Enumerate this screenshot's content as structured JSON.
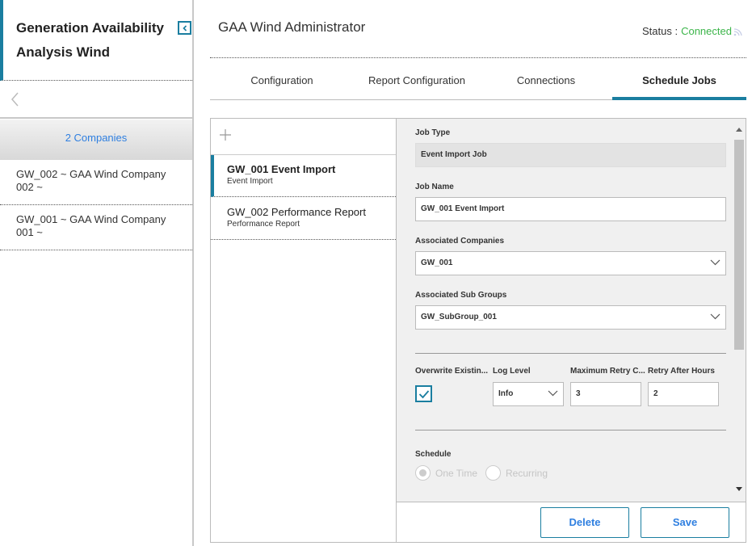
{
  "sidebar": {
    "title": "Generation Availability Analysis Wind",
    "companies_header": "2 Companies",
    "companies": [
      {
        "label": "GW_002 ~ GAA Wind Company 002 ~"
      },
      {
        "label": "GW_001 ~ GAA Wind Company 001 ~"
      }
    ]
  },
  "header": {
    "title": "GAA Wind Administrator",
    "status_label": "Status :",
    "status_value": "Connected"
  },
  "tabs": [
    {
      "label": "Configuration"
    },
    {
      "label": "Report Configuration"
    },
    {
      "label": "Connections"
    },
    {
      "label": "Schedule Jobs",
      "active": true
    }
  ],
  "jobs": [
    {
      "title": "GW_001 Event Import",
      "subtitle": "Event Import",
      "selected": true
    },
    {
      "title": "GW_002 Performance Report",
      "subtitle": "Performance Report"
    }
  ],
  "form": {
    "job_type_label": "Job Type",
    "job_type_value": "Event Import Job",
    "job_name_label": "Job Name",
    "job_name_value": "GW_001 Event Import",
    "associated_companies_label": "Associated Companies",
    "associated_companies_value": "GW_001",
    "associated_sub_groups_label": "Associated Sub Groups",
    "associated_sub_groups_value": "GW_SubGroup_001",
    "overwrite_label": "Overwrite Existin...",
    "overwrite_checked": true,
    "log_level_label": "Log Level",
    "log_level_value": "Info",
    "max_retry_label": "Maximum Retry C...",
    "max_retry_value": "3",
    "retry_after_label": "Retry After Hours",
    "retry_after_value": "2",
    "schedule_label": "Schedule",
    "schedule_options": [
      {
        "label": "One Time",
        "selected": true
      },
      {
        "label": "Recurring",
        "selected": false
      }
    ]
  },
  "footer": {
    "delete_label": "Delete",
    "save_label": "Save"
  },
  "icons": {
    "collapse": "chevron-left-icon",
    "back": "chevron-left-icon",
    "add": "plus-icon",
    "status": "wifi-icon",
    "dropdown": "chevron-down-icon",
    "check": "check-icon"
  },
  "colors": {
    "accent": "#1a7ea0",
    "link": "#2f7fe0",
    "connected": "#3cb54a"
  }
}
